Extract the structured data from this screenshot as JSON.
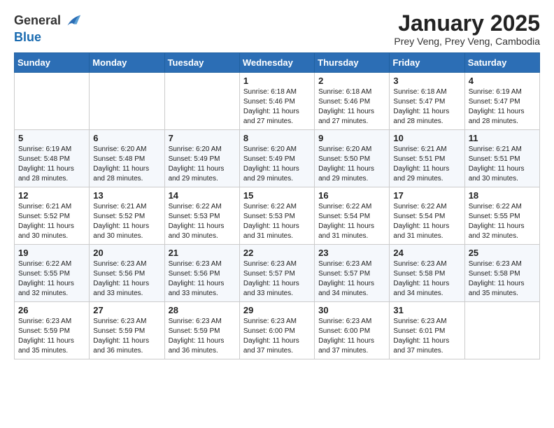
{
  "header": {
    "logo_line1": "General",
    "logo_line2": "Blue",
    "title": "January 2025",
    "subtitle": "Prey Veng, Prey Veng, Cambodia"
  },
  "days_of_week": [
    "Sunday",
    "Monday",
    "Tuesday",
    "Wednesday",
    "Thursday",
    "Friday",
    "Saturday"
  ],
  "weeks": [
    [
      {
        "day": "",
        "info": ""
      },
      {
        "day": "",
        "info": ""
      },
      {
        "day": "",
        "info": ""
      },
      {
        "day": "1",
        "info": "Sunrise: 6:18 AM\nSunset: 5:46 PM\nDaylight: 11 hours and 27 minutes."
      },
      {
        "day": "2",
        "info": "Sunrise: 6:18 AM\nSunset: 5:46 PM\nDaylight: 11 hours and 27 minutes."
      },
      {
        "day": "3",
        "info": "Sunrise: 6:18 AM\nSunset: 5:47 PM\nDaylight: 11 hours and 28 minutes."
      },
      {
        "day": "4",
        "info": "Sunrise: 6:19 AM\nSunset: 5:47 PM\nDaylight: 11 hours and 28 minutes."
      }
    ],
    [
      {
        "day": "5",
        "info": "Sunrise: 6:19 AM\nSunset: 5:48 PM\nDaylight: 11 hours and 28 minutes."
      },
      {
        "day": "6",
        "info": "Sunrise: 6:20 AM\nSunset: 5:48 PM\nDaylight: 11 hours and 28 minutes."
      },
      {
        "day": "7",
        "info": "Sunrise: 6:20 AM\nSunset: 5:49 PM\nDaylight: 11 hours and 29 minutes."
      },
      {
        "day": "8",
        "info": "Sunrise: 6:20 AM\nSunset: 5:49 PM\nDaylight: 11 hours and 29 minutes."
      },
      {
        "day": "9",
        "info": "Sunrise: 6:20 AM\nSunset: 5:50 PM\nDaylight: 11 hours and 29 minutes."
      },
      {
        "day": "10",
        "info": "Sunrise: 6:21 AM\nSunset: 5:51 PM\nDaylight: 11 hours and 29 minutes."
      },
      {
        "day": "11",
        "info": "Sunrise: 6:21 AM\nSunset: 5:51 PM\nDaylight: 11 hours and 30 minutes."
      }
    ],
    [
      {
        "day": "12",
        "info": "Sunrise: 6:21 AM\nSunset: 5:52 PM\nDaylight: 11 hours and 30 minutes."
      },
      {
        "day": "13",
        "info": "Sunrise: 6:21 AM\nSunset: 5:52 PM\nDaylight: 11 hours and 30 minutes."
      },
      {
        "day": "14",
        "info": "Sunrise: 6:22 AM\nSunset: 5:53 PM\nDaylight: 11 hours and 30 minutes."
      },
      {
        "day": "15",
        "info": "Sunrise: 6:22 AM\nSunset: 5:53 PM\nDaylight: 11 hours and 31 minutes."
      },
      {
        "day": "16",
        "info": "Sunrise: 6:22 AM\nSunset: 5:54 PM\nDaylight: 11 hours and 31 minutes."
      },
      {
        "day": "17",
        "info": "Sunrise: 6:22 AM\nSunset: 5:54 PM\nDaylight: 11 hours and 31 minutes."
      },
      {
        "day": "18",
        "info": "Sunrise: 6:22 AM\nSunset: 5:55 PM\nDaylight: 11 hours and 32 minutes."
      }
    ],
    [
      {
        "day": "19",
        "info": "Sunrise: 6:22 AM\nSunset: 5:55 PM\nDaylight: 11 hours and 32 minutes."
      },
      {
        "day": "20",
        "info": "Sunrise: 6:23 AM\nSunset: 5:56 PM\nDaylight: 11 hours and 33 minutes."
      },
      {
        "day": "21",
        "info": "Sunrise: 6:23 AM\nSunset: 5:56 PM\nDaylight: 11 hours and 33 minutes."
      },
      {
        "day": "22",
        "info": "Sunrise: 6:23 AM\nSunset: 5:57 PM\nDaylight: 11 hours and 33 minutes."
      },
      {
        "day": "23",
        "info": "Sunrise: 6:23 AM\nSunset: 5:57 PM\nDaylight: 11 hours and 34 minutes."
      },
      {
        "day": "24",
        "info": "Sunrise: 6:23 AM\nSunset: 5:58 PM\nDaylight: 11 hours and 34 minutes."
      },
      {
        "day": "25",
        "info": "Sunrise: 6:23 AM\nSunset: 5:58 PM\nDaylight: 11 hours and 35 minutes."
      }
    ],
    [
      {
        "day": "26",
        "info": "Sunrise: 6:23 AM\nSunset: 5:59 PM\nDaylight: 11 hours and 35 minutes."
      },
      {
        "day": "27",
        "info": "Sunrise: 6:23 AM\nSunset: 5:59 PM\nDaylight: 11 hours and 36 minutes."
      },
      {
        "day": "28",
        "info": "Sunrise: 6:23 AM\nSunset: 5:59 PM\nDaylight: 11 hours and 36 minutes."
      },
      {
        "day": "29",
        "info": "Sunrise: 6:23 AM\nSunset: 6:00 PM\nDaylight: 11 hours and 37 minutes."
      },
      {
        "day": "30",
        "info": "Sunrise: 6:23 AM\nSunset: 6:00 PM\nDaylight: 11 hours and 37 minutes."
      },
      {
        "day": "31",
        "info": "Sunrise: 6:23 AM\nSunset: 6:01 PM\nDaylight: 11 hours and 37 minutes."
      },
      {
        "day": "",
        "info": ""
      }
    ]
  ]
}
